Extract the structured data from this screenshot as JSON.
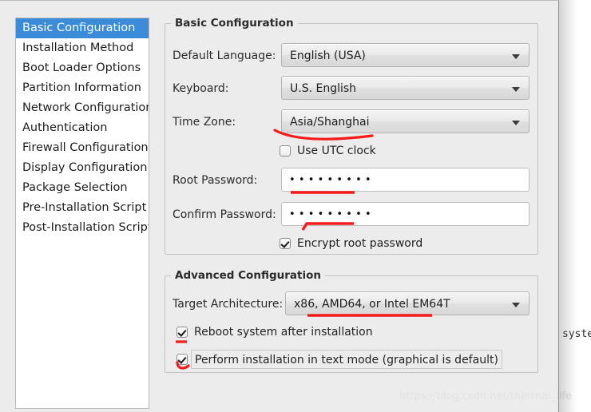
{
  "window": {
    "background_color": "#ececec",
    "accent_color": "#3b8cd8"
  },
  "sidebar": {
    "items": [
      {
        "label": "Basic Configuration",
        "selected": true
      },
      {
        "label": "Installation Method",
        "selected": false
      },
      {
        "label": "Boot Loader Options",
        "selected": false
      },
      {
        "label": "Partition Information",
        "selected": false
      },
      {
        "label": "Network Configuration",
        "selected": false
      },
      {
        "label": "Authentication",
        "selected": false
      },
      {
        "label": "Firewall Configuration",
        "selected": false
      },
      {
        "label": "Display Configuration",
        "selected": false
      },
      {
        "label": "Package Selection",
        "selected": false
      },
      {
        "label": "Pre-Installation Script",
        "selected": false
      },
      {
        "label": "Post-Installation Script",
        "selected": false
      }
    ]
  },
  "basic_group": {
    "title": "Basic Configuration",
    "default_language": {
      "label": "Default Language:",
      "value": "English (USA)",
      "arrow_icon": "chevron-down-icon"
    },
    "keyboard": {
      "label": "Keyboard:",
      "value": "U.S. English",
      "arrow_icon": "chevron-down-icon"
    },
    "time_zone": {
      "label": "Time Zone:",
      "value": "Asia/Shanghai",
      "arrow_icon": "chevron-down-icon"
    },
    "use_utc_clock": {
      "label": "Use UTC clock",
      "checked": false
    },
    "root_password": {
      "label": "Root Password:",
      "value": "•••••••••"
    },
    "confirm_password": {
      "label": "Confirm Password:",
      "value": "•••••••••"
    },
    "encrypt_root_password": {
      "label": "Encrypt root password",
      "checked": true
    }
  },
  "advanced_group": {
    "title": "Advanced Configuration",
    "target_architecture": {
      "label": "Target Architecture:",
      "value": "x86, AMD64, or Intel EM64T",
      "arrow_icon": "chevron-down-icon"
    },
    "reboot_after_install": {
      "label": "Reboot system after installation",
      "checked": true
    },
    "text_mode_install": {
      "label": "Perform installation in text mode (graphical is default)",
      "checked": true
    }
  },
  "annotations": {
    "color": "#f41b1b",
    "marks": [
      "underline-time-zone",
      "underline-root-password",
      "underline-confirm-password",
      "underline-target-architecture",
      "tick-reboot-checkbox",
      "tick-text-mode-checkbox"
    ]
  },
  "background": {
    "terminal_text": "syste"
  },
  "watermark": {
    "text": "https://blog.csdn.net/thermal_life"
  }
}
